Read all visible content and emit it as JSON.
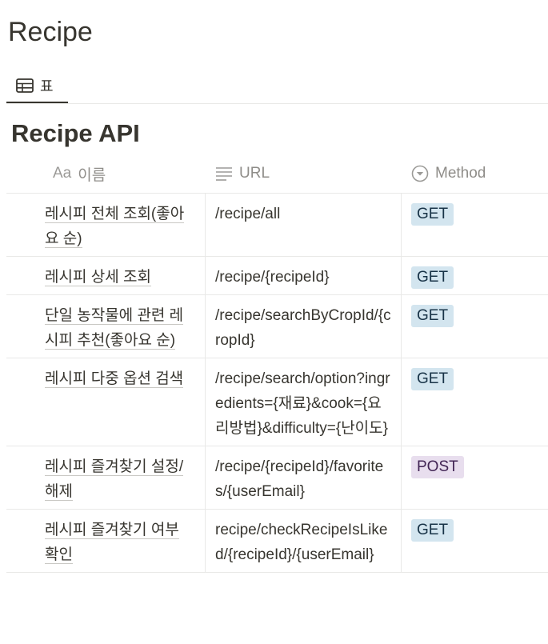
{
  "page": {
    "title": "Recipe"
  },
  "view_tab": {
    "label": "표",
    "icon": "table-icon"
  },
  "database": {
    "title": "Recipe API"
  },
  "columns": {
    "name": {
      "label": "이름",
      "icon": "title-property-icon",
      "icon_text": "Aa"
    },
    "url": {
      "label": "URL",
      "icon": "text-property-icon"
    },
    "method": {
      "label": "Method",
      "icon": "select-property-icon"
    }
  },
  "colors": {
    "get_bg": "#d3e5ef",
    "get_fg": "#183347",
    "post_bg": "#e8deee",
    "post_fg": "#412454"
  },
  "rows": [
    {
      "name": "레시피 전체 조회(좋아요 순)",
      "url": "/recipe/all",
      "method": "GET"
    },
    {
      "name": "레시피 상세 조회",
      "url": "/recipe/{recipeId}",
      "method": "GET"
    },
    {
      "name": "단일 농작물에 관련 레시피 추천(좋아요 순)",
      "url": "/recipe/searchByCropId/{cropId}",
      "method": "GET"
    },
    {
      "name": "레시피 다중 옵션 검색",
      "url": "/recipe/search/option?ingredients={재료}&cook={요리방법}&difficulty={난이도}",
      "method": "GET"
    },
    {
      "name": "레시피 즐겨찾기 설정/해제",
      "url": "/recipe/{recipeId}/favorites/{userEmail}",
      "method": "POST"
    },
    {
      "name": "레시피 즐겨찾기 여부 확인",
      "url": "recipe/checkRecipeIsLiked/{recipeId}/{userEmail}",
      "method": "GET"
    }
  ]
}
